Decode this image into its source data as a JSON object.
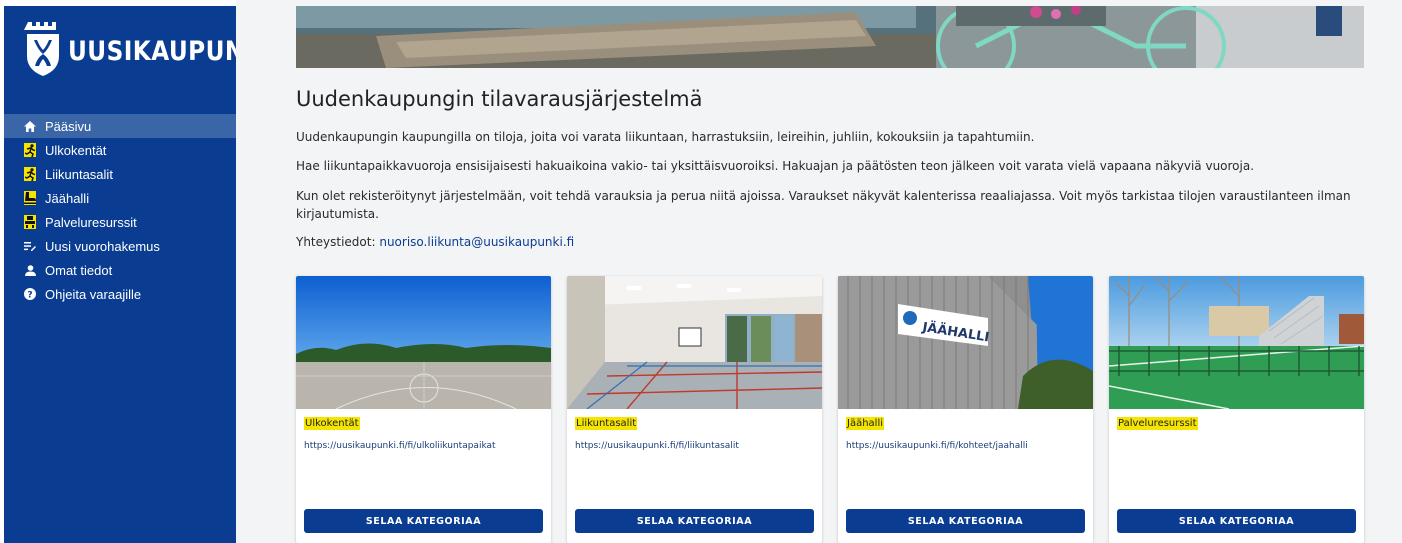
{
  "brand": {
    "name": "UUSIKAUPUNKI",
    "crest": "city-crest"
  },
  "nav": [
    {
      "label": "Pääsivu",
      "icon": "home-icon",
      "active": true
    },
    {
      "label": "Ulkokentät",
      "icon": "runner-icon"
    },
    {
      "label": "Liikuntasalit",
      "icon": "runner-icon"
    },
    {
      "label": "Jäähalli",
      "icon": "skate-icon"
    },
    {
      "label": "Palveluresurssit",
      "icon": "resource-icon"
    },
    {
      "label": "Uusi vuorohakemus",
      "icon": "list-edit-icon"
    },
    {
      "label": "Omat tiedot",
      "icon": "user-icon"
    },
    {
      "label": "Ohjeita varaajille",
      "icon": "help-icon"
    }
  ],
  "main": {
    "title": "Uudenkaupungin tilavarausjärjestelmä",
    "paragraphs": [
      "Uudenkaupungin kaupungilla on tiloja, joita voi varata liikuntaan, harrastuksiin, leireihin, juhliin, kokouksiin ja tapahtumiin.",
      "Hae liikuntapaikkavuoroja ensisijaisesti hakuaikoina vakio- tai yksittäisvuoroiksi. Hakuajan ja päätösten teon jälkeen voit varata vielä vapaana näkyviä vuoroja.",
      "Kun olet rekisteröitynyt järjestelmään, voit tehdä varauksia ja perua niitä ajoissa. Varaukset näkyvät kalenterissa reaaliajassa. Voit myös tarkistaa tilojen varaustilanteen ilman kirjautumista."
    ],
    "contact_label": "Yhteystiedot:",
    "contact_email": "nuoriso.liikunta@uusikaupunki.fi"
  },
  "cards": [
    {
      "title": "Ulkokentät",
      "link": "https://uusikaupunki.fi/fi/ulkoliikuntapaikat",
      "button": "SELAA KATEGORIAA"
    },
    {
      "title": "Liikuntasalit",
      "link": "https://uusikaupunki.fi/fi/liikuntasalit",
      "button": "SELAA KATEGORIAA"
    },
    {
      "title": "Jäähalli",
      "link": "https://uusikaupunki.fi/fi/kohteet/jaahalli",
      "button": "SELAA KATEGORIAA"
    },
    {
      "title": "Palveluresurssit",
      "link": "",
      "button": "SELAA KATEGORIAA"
    }
  ],
  "images": {
    "jaahalli_sign": "JÄÄHALLI"
  },
  "colors": {
    "brand": "#0a3d91",
    "active": "#3a66a8",
    "highlight": "#f5e400",
    "bg": "#f3f4f6"
  }
}
